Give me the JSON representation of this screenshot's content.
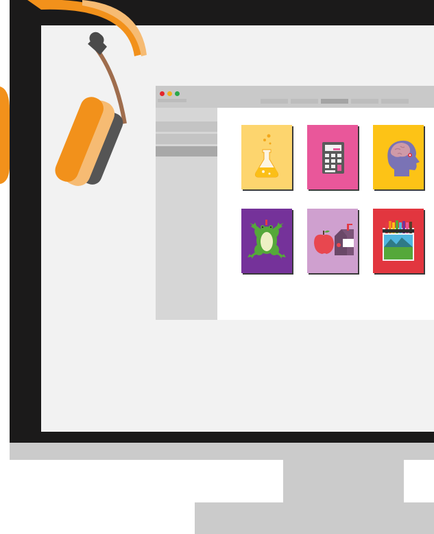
{
  "colors": {
    "bezel": "#1b1a1a",
    "screen": "#f2f2f2",
    "stand": "#cbcbcb",
    "headphones_orange": "#f2911b",
    "headphones_light_orange": "#f6bb73",
    "headband_brown": "#9f6d4d"
  },
  "window": {
    "traffic_lights": [
      "close",
      "minimize",
      "maximize"
    ],
    "tab_count": 5,
    "active_tab": 3,
    "sidebar_items": 3,
    "active_sidebar_item": 3
  },
  "tiles": [
    {
      "name": "chemistry",
      "icon": "flask-icon",
      "color": "#fdd56e"
    },
    {
      "name": "math",
      "icon": "calculator-icon",
      "color": "#e9579a"
    },
    {
      "name": "psychology",
      "icon": "head-brain-icon",
      "color": "#fdc316"
    },
    {
      "name": "biology",
      "icon": "frog-icon",
      "color": "#75329a"
    },
    {
      "name": "nutrition",
      "icon": "apple-milk-icon",
      "color": "#cfa0cf"
    },
    {
      "name": "art",
      "icon": "crayons-landscape-icon",
      "color": "#e2363f"
    }
  ]
}
